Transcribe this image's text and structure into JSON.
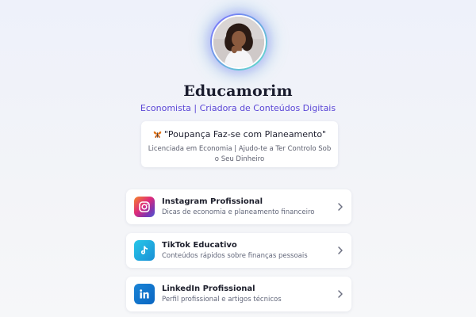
{
  "profile": {
    "name": "Educamorim",
    "subtitle": "Economista | Criadora de Conteúdos Digitais"
  },
  "quote": {
    "text": "\"Poupança Faz-se com Planeamento\"",
    "emoji_icon": "butterfly-icon",
    "description": "Licenciada em Economia | Ajudo-te a Ter Controlo Sob o Seu Dinheiro"
  },
  "links": [
    {
      "title": "Instagram Profissional",
      "description": "Dicas de economia e planeamento financeiro",
      "icon": "instagram-icon",
      "color": "#dd2a7b"
    },
    {
      "title": "TikTok Educativo",
      "description": "Conteúdos rápidos sobre finanças pessoais",
      "icon": "tiktok-icon",
      "color": "#1a8fd6"
    },
    {
      "title": "LinkedIn Profissional",
      "description": "Perfil profissional e artigos técnicos",
      "icon": "linkedin-icon",
      "color": "#0a66c2"
    }
  ],
  "colors": {
    "accent": "#5a45d6",
    "name_text": "#1a1c2e",
    "background": "#eef1fa"
  }
}
